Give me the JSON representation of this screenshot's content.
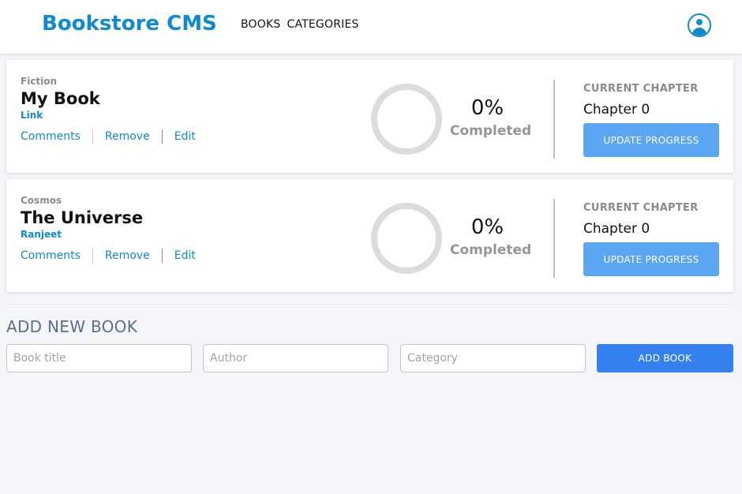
{
  "header": {
    "brand": "Bookstore CMS",
    "nav": [
      {
        "label": "BOOKS"
      },
      {
        "label": "CATEGORIES"
      }
    ],
    "user_icon": "user-circle-icon"
  },
  "books": [
    {
      "genre": "Fiction",
      "title": "My Book",
      "author": "Link",
      "actions": {
        "comments": "Comments",
        "remove": "Remove",
        "edit": "Edit"
      },
      "percent": "0%",
      "completed_label": "Completed",
      "current_chapter_label": "CURRENT CHAPTER",
      "chapter": "Chapter 0",
      "update_label": "UPDATE PROGRESS"
    },
    {
      "genre": "Cosmos",
      "title": "The Universe",
      "author": "Ranjeet",
      "actions": {
        "comments": "Comments",
        "remove": "Remove",
        "edit": "Edit"
      },
      "percent": "0%",
      "completed_label": "Completed",
      "current_chapter_label": "CURRENT CHAPTER",
      "chapter": "Chapter 0",
      "update_label": "UPDATE PROGRESS"
    }
  ],
  "add_form": {
    "heading": "ADD NEW BOOK",
    "title_placeholder": "Book title",
    "author_placeholder": "Author",
    "category_placeholder": "Category",
    "submit_label": "ADD BOOK"
  },
  "colors": {
    "brand": "#0f8ad0",
    "link": "#0f8ad0",
    "update_button": "#5aa6f2",
    "add_button": "#3580ef",
    "page_bg": "#f4f5f9"
  }
}
